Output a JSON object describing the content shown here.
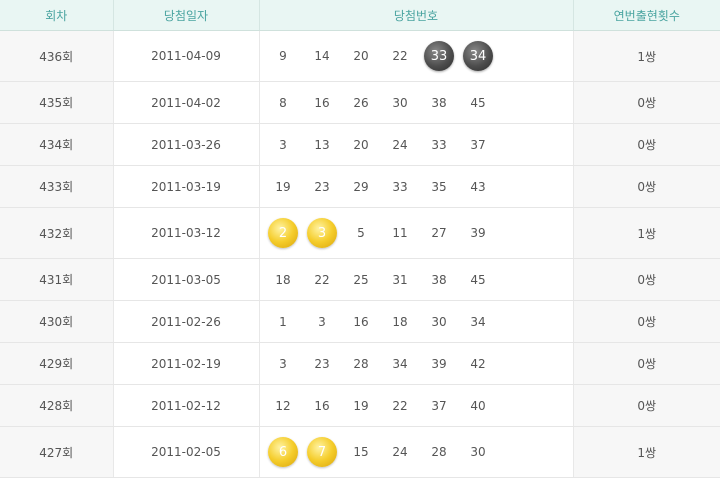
{
  "headers": {
    "round": "회차",
    "date": "당첨일자",
    "numbers": "당첨번호",
    "consecutive": "연번출현횟수"
  },
  "rows": [
    {
      "round": "436회",
      "date": "2011-04-09",
      "numbers": [
        "9",
        "14",
        "20",
        "22",
        "33",
        "34"
      ],
      "highlight": [
        4,
        5
      ],
      "style": "dark",
      "count": "1쌍"
    },
    {
      "round": "435회",
      "date": "2011-04-02",
      "numbers": [
        "8",
        "16",
        "26",
        "30",
        "38",
        "45"
      ],
      "highlight": [],
      "style": "",
      "count": "0쌍"
    },
    {
      "round": "434회",
      "date": "2011-03-26",
      "numbers": [
        "3",
        "13",
        "20",
        "24",
        "33",
        "37"
      ],
      "highlight": [],
      "style": "",
      "count": "0쌍"
    },
    {
      "round": "433회",
      "date": "2011-03-19",
      "numbers": [
        "19",
        "23",
        "29",
        "33",
        "35",
        "43"
      ],
      "highlight": [],
      "style": "",
      "count": "0쌍"
    },
    {
      "round": "432회",
      "date": "2011-03-12",
      "numbers": [
        "2",
        "3",
        "5",
        "11",
        "27",
        "39"
      ],
      "highlight": [
        0,
        1
      ],
      "style": "gold",
      "count": "1쌍"
    },
    {
      "round": "431회",
      "date": "2011-03-05",
      "numbers": [
        "18",
        "22",
        "25",
        "31",
        "38",
        "45"
      ],
      "highlight": [],
      "style": "",
      "count": "0쌍"
    },
    {
      "round": "430회",
      "date": "2011-02-26",
      "numbers": [
        "1",
        "3",
        "16",
        "18",
        "30",
        "34"
      ],
      "highlight": [],
      "style": "",
      "count": "0쌍"
    },
    {
      "round": "429회",
      "date": "2011-02-19",
      "numbers": [
        "3",
        "23",
        "28",
        "34",
        "39",
        "42"
      ],
      "highlight": [],
      "style": "",
      "count": "0쌍"
    },
    {
      "round": "428회",
      "date": "2011-02-12",
      "numbers": [
        "12",
        "16",
        "19",
        "22",
        "37",
        "40"
      ],
      "highlight": [],
      "style": "",
      "count": "0쌍"
    },
    {
      "round": "427회",
      "date": "2011-02-05",
      "numbers": [
        "6",
        "7",
        "15",
        "24",
        "28",
        "30"
      ],
      "highlight": [
        0,
        1
      ],
      "style": "gold",
      "count": "1쌍"
    }
  ]
}
